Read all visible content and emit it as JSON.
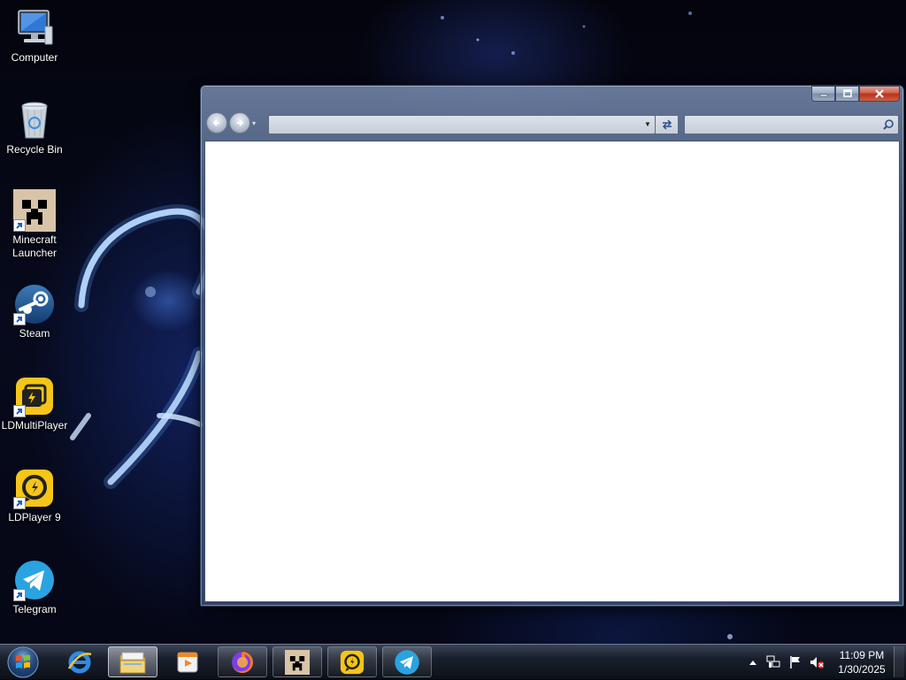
{
  "desktop": {
    "icons": [
      {
        "label": "Computer",
        "icon": "computer-icon",
        "shortcut": false
      },
      {
        "label": "Recycle Bin",
        "icon": "recycle-bin-icon",
        "shortcut": false
      },
      {
        "label": "Minecraft Launcher",
        "icon": "minecraft-creeper-icon",
        "shortcut": true
      },
      {
        "label": "Steam",
        "icon": "steam-icon",
        "shortcut": true
      },
      {
        "label": "LDMultiPlayer",
        "icon": "ldmultiplayer-icon",
        "shortcut": true
      },
      {
        "label": "LDPlayer 9",
        "icon": "ldplayer-icon",
        "shortcut": true
      },
      {
        "label": "Telegram",
        "icon": "telegram-icon",
        "shortcut": true
      }
    ]
  },
  "window": {
    "address_value": "",
    "search_placeholder": "",
    "caption": {
      "minimize": "minimize-icon",
      "maximize": "maximize-icon",
      "close": "close-icon"
    }
  },
  "taskbar": {
    "pinned": [
      {
        "name": "internet-explorer",
        "icon": "internet-explorer-icon",
        "active": false
      },
      {
        "name": "windows-explorer",
        "icon": "folder-icon",
        "active": true
      },
      {
        "name": "media-player",
        "icon": "media-player-icon",
        "active": false
      },
      {
        "name": "firefox",
        "icon": "firefox-icon",
        "active": false
      },
      {
        "name": "minecraft-launcher",
        "icon": "minecraft-creeper-icon",
        "active": false
      },
      {
        "name": "ldplayer",
        "icon": "ldplayer-icon",
        "active": false
      },
      {
        "name": "telegram",
        "icon": "telegram-icon",
        "active": false
      }
    ],
    "tray": {
      "icons": [
        "show-hidden-icons-arrow",
        "network-icon",
        "action-center-flag-icon",
        "volume-muted-icon"
      ],
      "time": "11:09 PM",
      "date": "1/30/2025"
    }
  },
  "colors": {
    "ld_yellow": "#f5c518",
    "telegram_blue": "#2aa3e0",
    "steam_blue": "#1b4f8a",
    "close_red": "#c8402a"
  }
}
